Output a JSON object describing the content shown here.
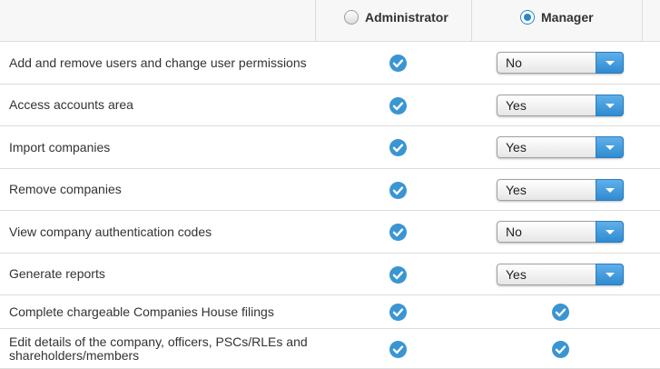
{
  "header": {
    "roles": [
      {
        "label": "Administrator",
        "selected": false
      },
      {
        "label": "Manager",
        "selected": true
      }
    ]
  },
  "colors": {
    "accent": "#3a95d3",
    "divider": "#dcdcdc",
    "header_bg": "#f7f7f7"
  },
  "permissions": [
    {
      "label": "Add and remove users and change user permissions",
      "administrator": "checked",
      "manager": "No"
    },
    {
      "label": "Access accounts area",
      "administrator": "checked",
      "manager": "Yes"
    },
    {
      "label": "Import companies",
      "administrator": "checked",
      "manager": "Yes"
    },
    {
      "label": "Remove companies",
      "administrator": "checked",
      "manager": "Yes"
    },
    {
      "label": "View company authentication codes",
      "administrator": "checked",
      "manager": "No"
    },
    {
      "label": "Generate reports",
      "administrator": "checked",
      "manager": "Yes"
    },
    {
      "label": "Complete chargeable Companies House filings",
      "administrator": "checked",
      "manager": "checked"
    },
    {
      "label": "Edit details of the company, officers, PSCs/RLEs and shareholders/members",
      "administrator": "checked",
      "manager": "checked"
    }
  ]
}
